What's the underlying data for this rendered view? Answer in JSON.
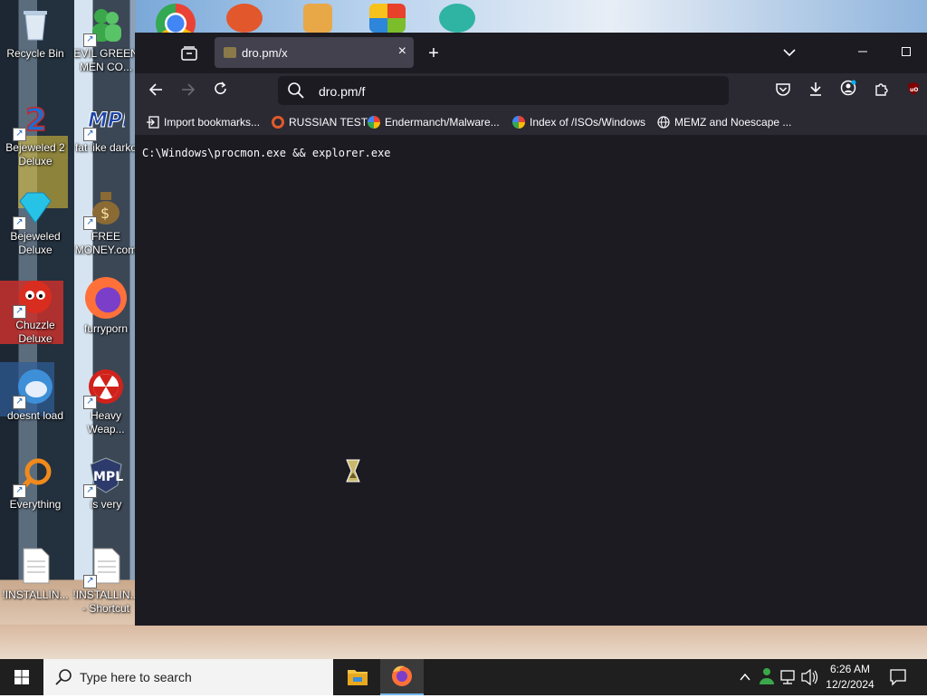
{
  "desktop": {
    "icons": [
      {
        "label": "Recycle Bin",
        "color": "#8fb3d9"
      },
      {
        "label": "EVIL GREEN MEN CO...",
        "color": "#3aa84a"
      },
      {
        "label": "Bejeweled 2 Deluxe",
        "color": "#1c6fd1"
      },
      {
        "label": "fat like darko",
        "color": "#1d46a8"
      },
      {
        "label": "Bejeweled Deluxe",
        "color": "#27c3e6"
      },
      {
        "label": "FREE MONEY.com",
        "color": "#8b6a34"
      },
      {
        "label": "Chuzzle Deluxe",
        "color": "#d92d1f"
      },
      {
        "label": "furryporn",
        "color": "#ff7139"
      },
      {
        "label": "doesnt load",
        "color": "#3d8fd8"
      },
      {
        "label": "Heavy Weap...",
        "color": "#d0221b"
      },
      {
        "label": "Everything",
        "color": "#f08a1c"
      },
      {
        "label": "is very",
        "color": "#2d3a6c"
      },
      {
        "label": "!INSTALLIN...",
        "color": "#f2f2f2"
      },
      {
        "label": "!INSTALLIN... - Shortcut",
        "color": "#f2f2f2"
      }
    ]
  },
  "browser": {
    "tab_title": "dro.pm/x",
    "tab_close_icon": "×",
    "new_tab_icon": "+",
    "url_text": "dro.pm/f",
    "bookmarks": [
      {
        "label": "Import bookmarks...",
        "icon": "import-icon"
      },
      {
        "label": "RUSSIAN TEST",
        "icon": "ring-icon"
      },
      {
        "label": "Endermanch/Malware...",
        "icon": "google-icon"
      },
      {
        "label": "Index of /ISOs/Windows",
        "icon": "google-icon"
      },
      {
        "label": "MEMZ and Noescape ...",
        "icon": "globe-icon"
      }
    ],
    "page_text": "C:\\Windows\\procmon.exe && explorer.exe"
  },
  "taskbar": {
    "search_placeholder": "Type here to search",
    "time": "6:26 AM",
    "date": "12/2/2024"
  },
  "colors": {
    "browser_bg": "#1c1b22",
    "toolbar_bg": "#2b2a33",
    "tab_active_bg": "#42414d",
    "taskbar_bg": "#1f1f1f",
    "accent_blue": "#0078d4"
  }
}
